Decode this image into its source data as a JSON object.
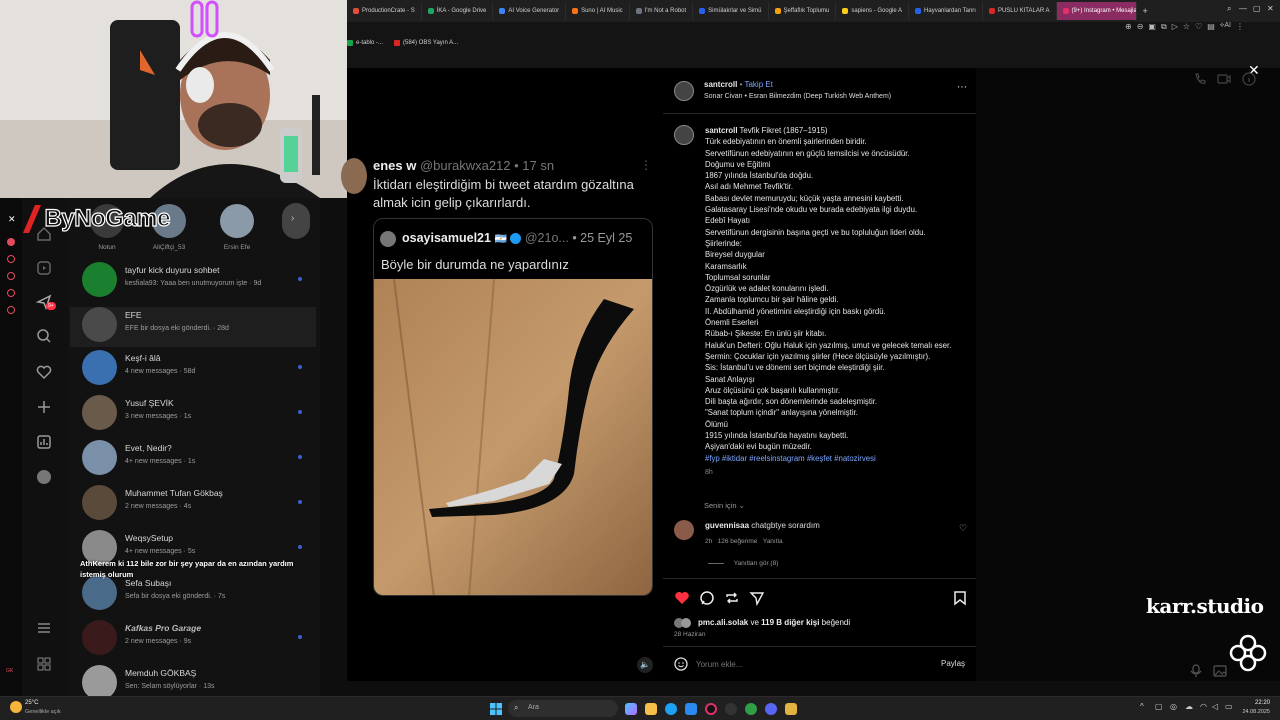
{
  "browser": {
    "tabs": [
      {
        "label": "ProductionCrate - S",
        "color": "#e34b3c"
      },
      {
        "label": "İKA - Google Drive",
        "color": "#1fa463"
      },
      {
        "label": "AI Voice Generator",
        "color": "#3b82f6"
      },
      {
        "label": "Suno | AI Music",
        "color": "#f97316"
      },
      {
        "label": "I'm Not a Robot",
        "color": "#6b7280"
      },
      {
        "label": "Simülakrlar ve Simü",
        "color": "#2563eb"
      },
      {
        "label": "Şeffaflık Toplumu",
        "color": "#f59e0b"
      },
      {
        "label": "sapiens - Google A",
        "color": "#facc15"
      },
      {
        "label": "Hayvanlardan Tanrı",
        "color": "#2563eb"
      },
      {
        "label": "PUSLU KITALAR A",
        "color": "#dc2626"
      },
      {
        "label": "(9+) Instagram • Mesajlar",
        "color": "#e1306c"
      }
    ],
    "new_tab": "+",
    "bookmarks": [
      {
        "label": "e-tablo -...",
        "color": "#16a34a"
      },
      {
        "label": "(584) OBS Yayın A...",
        "color": "#dc2626"
      }
    ]
  },
  "stream_overlay": {
    "channel_logo": "ByNoGame",
    "chat_user": "AthKerem",
    "chat_message": "ki 112 bile zor bir şey yapar da en azından yardım istemiş olurum",
    "watermark": "karr.studio"
  },
  "stories": [
    {
      "name": "Notun"
    },
    {
      "name": "AliÇiftçi_53"
    },
    {
      "name": "Ersin Efe"
    }
  ],
  "dm_list": [
    {
      "name": "tayfur kick duyuru sohbet",
      "sub": "kesfiala93: Yaaa ben unutmuyorum işte · 9d",
      "color": "#1a7f2e",
      "unread": true
    },
    {
      "name": "EFE",
      "sub": "EFE bir dosya eki gönderdi. · 28d",
      "color": "#4a4a4a",
      "unread": false
    },
    {
      "name": "Keşf-i âlâ",
      "sub": "4 new messages · 58d",
      "color": "#3a6fb0",
      "unread": true
    },
    {
      "name": "Yusuf ŞEVİK",
      "sub": "3 new messages · 1s",
      "color": "#6a5a4a",
      "unread": true
    },
    {
      "name": "Evet, Nedir?",
      "sub": "4+ new messages · 1s",
      "color": "#7a8fa8",
      "unread": true
    },
    {
      "name": "Muhammet Tufan Gökbaş",
      "sub": "2 new messages · 4s",
      "color": "#5a4a3a",
      "unread": true
    },
    {
      "name": "WeqsySetup",
      "sub": "4+ new messages · 5s",
      "color": "#8a8a8a",
      "unread": true
    },
    {
      "name": "Sefa Subaşı",
      "sub": "Sefa bir dosya eki gönderdi. · 7s",
      "color": "#4a6a8a",
      "unread": false
    },
    {
      "name": "Kafkas Pro Garage",
      "sub": "2 new messages · 9s",
      "color": "#3a1a1a",
      "unread": true
    },
    {
      "name": "Memduh GÖKBAŞ",
      "sub": "Sen: Selam söylüyorlar · 13s",
      "color": "#9a9a9a",
      "unread": false
    }
  ],
  "nav": {
    "badge": "9+"
  },
  "tweet": {
    "author": "enes w",
    "handle": "@burakwxa212",
    "time": "• 17 sn",
    "text": "İktidarı eleştirdiğim bi tweet atardım gözaltına almak icin gelip çıkarırlardı.",
    "quoted": {
      "author": "osayisamuel21",
      "flag": "🇦🇷",
      "handle": "@21o...",
      "time": "• 25 Eyl 25",
      "text": "Böyle bir durumda ne yapardınız"
    }
  },
  "post": {
    "username": "santcroll",
    "follow": "Takip Et",
    "audio": "Sonar Civan • Esran Bilmezdim (Deep Turkish Web Anthem)",
    "caption_user": "santcroll",
    "caption_lines": [
      "Tevfik Fikret (1867–1915)",
      "Türk edebiyatının en önemli şairlerinden biridir.",
      "Servetifünun edebiyatının en güçlü temsilcisi ve öncüsüdür.",
      "Doğumu ve Eğitimi",
      "1867 yılında İstanbul'da doğdu.",
      "Asıl adı Mehmet Tevfik'tir.",
      "Babası devlet memuruydu; küçük yaşta annesini kaybetti.",
      "Galatasaray Lisesi'nde okudu ve burada edebiyata ilgi duydu.",
      "Edebî Hayatı",
      "Servetifünun dergisinin başına geçti ve bu topluluğun lideri oldu.",
      "Şiirlerinde:",
      "Bireysel duygular",
      "Karamsarlık",
      "Toplumsal sorunlar",
      "Özgürlük ve adalet konularını işledi.",
      "Zamanla toplumcu bir şair hâline geldi.",
      "II. Abdülhamid yönetimini eleştirdiği için baskı gördü.",
      "Önemli Eserleri",
      "Rübab-ı Şikeste: En ünlü şiir kitabı.",
      "Haluk'un Defteri: Oğlu Haluk için yazılmış, umut ve gelecek temalı eser.",
      "Şermin: Çocuklar için yazılmış şiirler (Hece ölçüsüyle yazılmıştır).",
      "Sis: İstanbul'u ve dönemi sert biçimde eleştirdiği şiir.",
      "Sanat Anlayışı",
      "Aruz ölçüsünü çok başarılı kullanmıştır.",
      "Dili başta ağırdır, son dönemlerinde sadeleşmiştir.",
      "\"Sanat toplum içindir\" anlayışına yönelmiştir.",
      "Ölümü",
      "1915 yılında İstanbul'da hayatını kaybetti.",
      "Aşiyan'daki evi bugün müzedir."
    ],
    "hashtags": "#fyp #iktidar #reelsinstagram #keşfet #natozirvesi",
    "age": "8h",
    "filter": "Senin için",
    "comment": {
      "user": "guvennisaa",
      "text": "chatgbtye sorardım",
      "time": "2h",
      "likes": "126 beğenme",
      "reply": "Yanıtla",
      "view_replies": "Yanıtları gör (8)"
    },
    "likes_user": "pmc.ali.solak",
    "likes_connector": "ve",
    "likes_others": "119 B diğer kişi",
    "likes_suffix": "beğendi",
    "date": "28 Haziran",
    "comment_placeholder": "Yorum ekle...",
    "share_button": "Paylaş"
  },
  "taskbar": {
    "weather_temp": "25°C",
    "weather_desc": "Genellikle açık",
    "search_placeholder": "Ara",
    "time": "22:20",
    "date": "24.08.2025"
  },
  "colors": {
    "accent": "#8a2b62",
    "link": "#7aa6ff",
    "like": "#ff3040"
  }
}
